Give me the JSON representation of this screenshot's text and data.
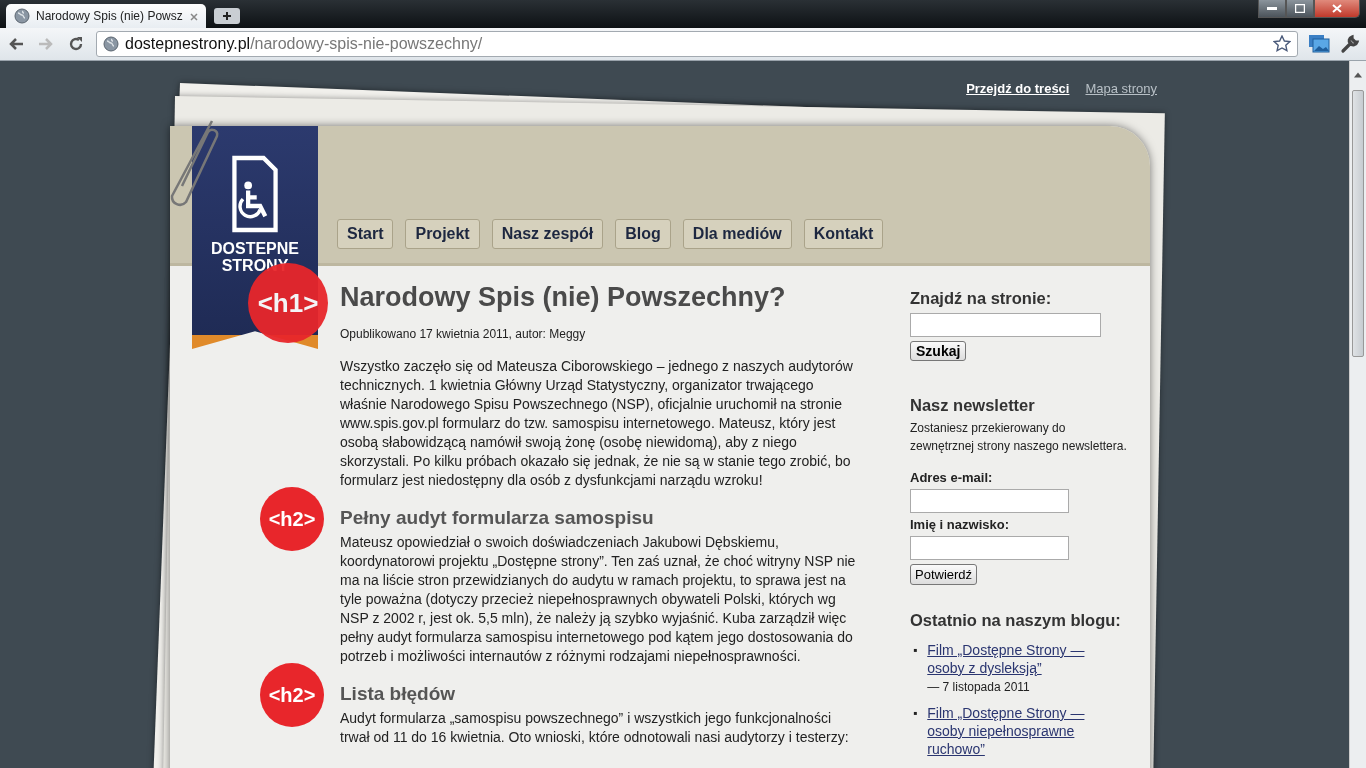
{
  "browser": {
    "tab_title": "Narodowy Spis (nie) Powsz",
    "url_domain": "dostepnestrony.pl",
    "url_path": "/narodowy-spis-nie-powszechny/"
  },
  "skip_links": [
    {
      "label": "Przejdź do treści",
      "kind": "primary"
    },
    {
      "label": "Mapa strony",
      "kind": "secondary"
    }
  ],
  "logo": {
    "line1": "DOSTEPNE",
    "line2": "STRONY"
  },
  "nav": [
    {
      "label": "Start",
      "selected": false
    },
    {
      "label": "Projekt",
      "selected": false
    },
    {
      "label": "Nasz zespół",
      "selected": false
    },
    {
      "label": "Blog",
      "selected": false
    },
    {
      "label": "Dla mediów",
      "selected": false
    },
    {
      "label": "Kontakt",
      "selected": false
    }
  ],
  "article": {
    "badge": "<h1>",
    "title": "Narodowy Spis (nie) Powszechny?",
    "meta": "Opublikowano 17 kwietnia 2011, autor: Meggy",
    "intro": "Wszystko zaczęło się od Mateusza Ciborowskiego – jednego z naszych audytorów technicznych. 1 kwietnia Główny Urząd Statystyczny, organizator trwającego właśnie Narodowego Spisu Powszechnego (NSP), oficjalnie uruchomił na stronie www.spis.gov.pl formularz do tzw. samospisu internetowego. Mateusz, który jest osobą słabowidzącą namówił swoją żonę (osobę niewidomą), aby z niego skorzystali. Po kilku próbach okazało się jednak, że nie są w stanie tego zrobić, bo formularz jest niedostępny dla osób z dysfunkcjami narządu wzroku!",
    "sections": [
      {
        "badge": "<h2>",
        "title": "Pełny audyt formularza samospisu",
        "text": "Mateusz opowiedział o swoich doświadczeniach Jakubowi Dębskiemu, koordynatorowi projektu „Dostępne strony”. Ten zaś uznał, że choć witryny NSP nie ma na liście stron przewidzianych do audytu w ramach projektu, to sprawa jest na tyle poważna (dotyczy przecież niepełnosprawnych obywateli Polski, których wg NSP z 2002 r, jest ok. 5,5 mln), że należy ją szybko wyjaśnić. Kuba zarządził więc pełny audyt formularza samospisu internetowego pod kątem jego dostosowania do potrzeb i możliwości internautów z różnymi rodzajami niepełnosprawności."
      },
      {
        "badge": "<h2>",
        "title": "Lista błędów",
        "text": "Audyt formularza „samospisu powszechnego” i wszystkich jego funkcjonalności trwał od 11 do 16 kwietnia. Oto wnioski, które odnotowali nasi audytorzy i testerzy:"
      }
    ]
  },
  "sidebar": {
    "search": {
      "heading": "Znajdź na stronie:",
      "button": "Szukaj"
    },
    "newsletter": {
      "heading": "Nasz newsletter",
      "description": "Zostaniesz przekierowany do zewnętrznej strony naszego newslettera.",
      "fields": [
        {
          "label": "Adres e-mail:"
        },
        {
          "label": "Imię i nazwisko:"
        }
      ],
      "button": "Potwierdź"
    },
    "blog": {
      "heading": "Ostatnio na naszym blogu:",
      "posts": [
        {
          "bullet": "▪",
          "title": "Film „Dostępne Strony — osoby z dysleksją”",
          "date": "— 7 listopada 2011"
        },
        {
          "bullet": "▪",
          "title": "Film „Dostępne Strony — osoby niepełnosprawne ruchowo”"
        }
      ]
    }
  }
}
